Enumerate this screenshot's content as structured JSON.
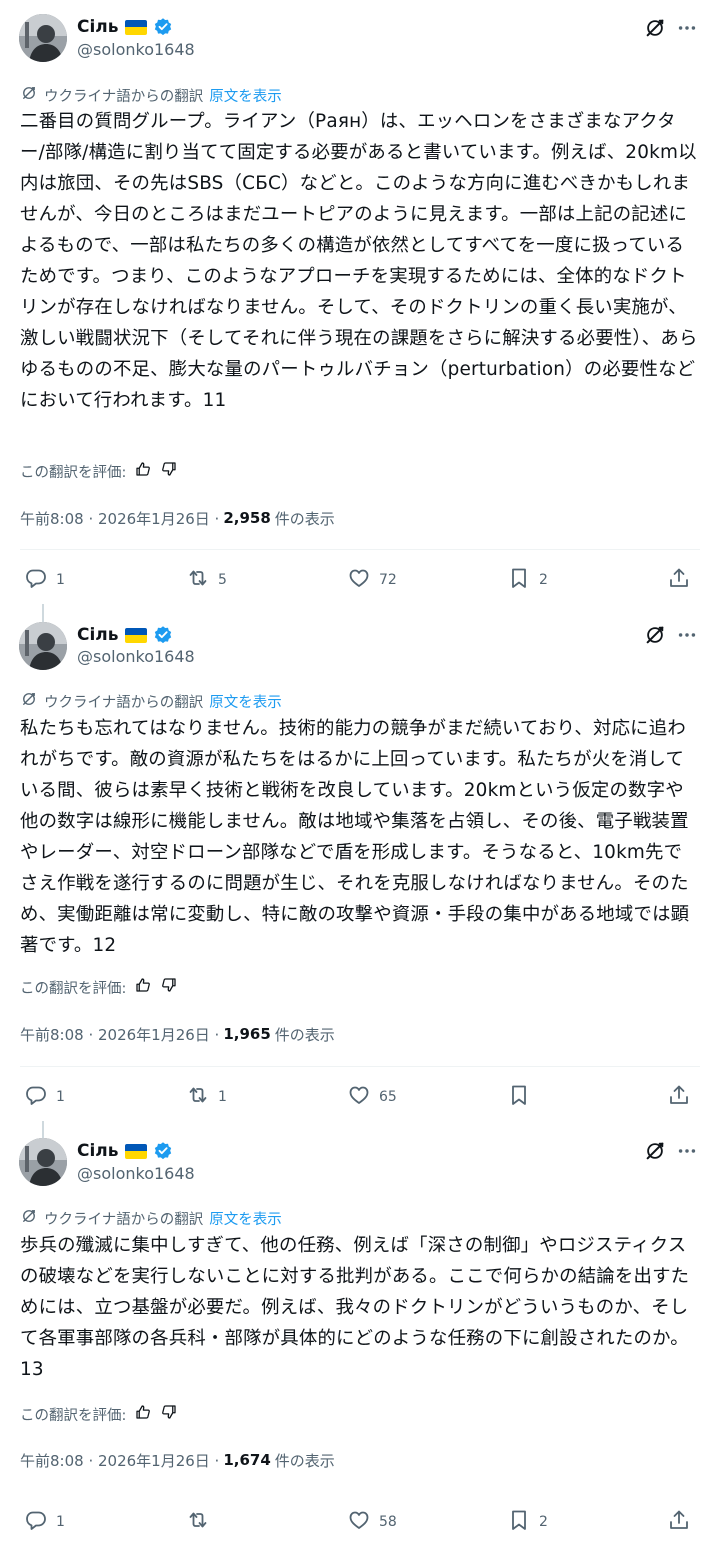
{
  "author": {
    "name": "Сіль",
    "handle": "@solonko1648"
  },
  "translation": {
    "label": "ウクライナ語からの翻訳",
    "show_original": "原文を表示",
    "rate": "この翻訳を評価:"
  },
  "views_suffix": "件の表示",
  "tweets": [
    {
      "text": "二番目の質問グループ。ライアン（Раян）は、エッヘロンをさまざまなアクター/部隊/構造に割り当てて固定する必要があると書いています。例えば、20km以内は旅団、その先はSBS（СБС）などと。このような方向に進むべきかもしれませんが、今日のところはまだユートピアのように見えます。一部は上記の記述によるもので、一部は私たちの多くの構造が依然としてすべてを一度に扱っているためです。つまり、このようなアプローチを実現するためには、全体的なドクトリンが存在しなければなりません。そして、そのドクトリンの重く長い実施が、激しい戦闘状況下（そしてそれに伴う現在の課題をさらに解決する必要性）、あらゆるものの不足、膨大な量のパートゥルバチョン（perturbation）の必要性などにおいて行われます。11",
      "time": "午前8:08 · 2026年1月26日 ·",
      "views": "2,958",
      "replies": "1",
      "reposts": "5",
      "likes": "72",
      "bookmarks": "2"
    },
    {
      "text": "私たちも忘れてはなりません。技術的能力の競争がまだ続いており、対応に追われがちです。敵の資源が私たちをはるかに上回っています。私たちが火を消している間、彼らは素早く技術と戦術を改良しています。20kmという仮定の数字や他の数字は線形に機能しません。敵は地域や集落を占領し、その後、電子戦装置やレーダー、対空ドローン部隊などで盾を形成します。そうなると、10km先でさえ作戦を遂行するのに問題が生じ、それを克服しなければなりません。そのため、実働距離は常に変動し、特に敵の攻撃や資源・手段の集中がある地域では顕著です。12",
      "time": "午前8:08 · 2026年1月26日 ·",
      "views": "1,965",
      "replies": "1",
      "reposts": "1",
      "likes": "65",
      "bookmarks": ""
    },
    {
      "text": "歩兵の殲滅に集中しすぎて、他の任務、例えば「深さの制御」やロジスティクスの破壊などを実行しないことに対する批判がある。ここで何らかの結論を出すためには、立つ基盤が必要だ。例えば、我々のドクトリンがどういうものか、そして各軍事部隊の各兵科・部隊が具体的にどのような任務の下に創設されたのか。13",
      "time": "午前8:08 · 2026年1月26日 ·",
      "views": "1,674",
      "replies": "1",
      "reposts": "",
      "likes": "58",
      "bookmarks": "2"
    }
  ]
}
